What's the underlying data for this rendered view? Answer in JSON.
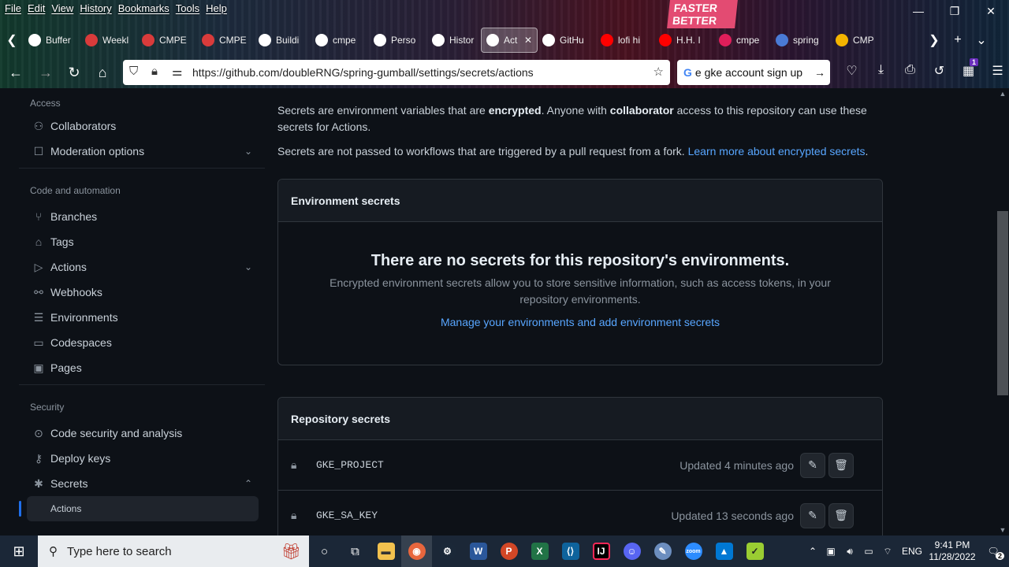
{
  "browser": {
    "menu": [
      "File",
      "Edit",
      "View",
      "History",
      "Bookmarks",
      "Tools",
      "Help"
    ],
    "window_controls": [
      "—",
      "❐",
      "✕"
    ],
    "poster_text": "FASTER BETTER",
    "tabs": [
      {
        "label": "Buffer",
        "color": "#ffffff"
      },
      {
        "label": "Weekl",
        "color": "#d93b3b"
      },
      {
        "label": "CMPE",
        "color": "#d93b3b"
      },
      {
        "label": "CMPE",
        "color": "#d93b3b"
      },
      {
        "label": "Buildi",
        "color": "#ffffff"
      },
      {
        "label": "cmpe",
        "color": "#ffffff"
      },
      {
        "label": "Perso",
        "color": "#ffffff"
      },
      {
        "label": "Histor",
        "color": "#ffffff"
      },
      {
        "label": "Act",
        "color": "#ffffff",
        "active": true
      },
      {
        "label": "GitHu",
        "color": "#ffffff"
      },
      {
        "label": "lofi hi",
        "color": "#ff0000"
      },
      {
        "label": "H.H. I",
        "color": "#ff0000"
      },
      {
        "label": "cmpe",
        "color": "#e01e5a"
      },
      {
        "label": "spring",
        "color": "#4a7bd6"
      },
      {
        "label": "CMP",
        "color": "#f4b400"
      }
    ],
    "url": "https://github.com/doubleRNG/spring-gumball/settings/secrets/actions",
    "search_text": "e gke account sign up",
    "notif_count": "1"
  },
  "sidebar": {
    "sections": [
      {
        "heading": "Access",
        "items": [
          {
            "label": "Collaborators",
            "icon": "person-icon",
            "glyph": "⚇",
            "chevron": false
          },
          {
            "label": "Moderation options",
            "icon": "comment-icon",
            "glyph": "☐",
            "chevron": true
          }
        ]
      },
      {
        "heading": "Code and automation",
        "items": [
          {
            "label": "Branches",
            "icon": "branch-icon",
            "glyph": "⑂",
            "chevron": false
          },
          {
            "label": "Tags",
            "icon": "tag-icon",
            "glyph": "⌂",
            "chevron": false
          },
          {
            "label": "Actions",
            "icon": "play-icon",
            "glyph": "▷",
            "chevron": true
          },
          {
            "label": "Webhooks",
            "icon": "webhook-icon",
            "glyph": "⚯",
            "chevron": false
          },
          {
            "label": "Environments",
            "icon": "server-icon",
            "glyph": "☰",
            "chevron": false
          },
          {
            "label": "Codespaces",
            "icon": "codespaces-icon",
            "glyph": "▭",
            "chevron": false
          },
          {
            "label": "Pages",
            "icon": "browser-icon",
            "glyph": "▣",
            "chevron": false
          }
        ]
      },
      {
        "heading": "Security",
        "items": [
          {
            "label": "Code security and analysis",
            "icon": "codescan-icon",
            "glyph": "⊙",
            "chevron": false
          },
          {
            "label": "Deploy keys",
            "icon": "key-icon",
            "glyph": "⚷",
            "chevron": false
          },
          {
            "label": "Secrets",
            "icon": "asterisk-icon",
            "glyph": "✱",
            "chevron": true,
            "expanded": true
          }
        ],
        "sub_item": "Actions"
      }
    ]
  },
  "main": {
    "intro": {
      "p1_a": "Secrets are environment variables that are ",
      "p1_b": "encrypted",
      "p1_c": ". Anyone with ",
      "p1_d": "collaborator",
      "p1_e": " access to this repository can use these secrets for Actions.",
      "p2": "Secrets are not passed to workflows that are triggered by a pull request from a fork. ",
      "p2_link": "Learn more about encrypted secrets",
      "p2_end": "."
    },
    "env_secrets": {
      "heading": "Environment secrets",
      "blank_title": "There are no secrets for this repository's environments.",
      "blank_desc": "Encrypted environment secrets allow you to store sensitive information, such as access tokens, in your repository environments.",
      "link": "Manage your environments and add environment secrets"
    },
    "repo_secrets": {
      "heading": "Repository secrets",
      "rows": [
        {
          "name": "GKE_PROJECT",
          "updated": "Updated 4 minutes ago"
        },
        {
          "name": "GKE_SA_KEY",
          "updated": "Updated 13 seconds ago"
        }
      ]
    }
  },
  "taskbar": {
    "search_placeholder": "Type here to search",
    "language": "ENG",
    "time": "9:41 PM",
    "date": "11/28/2022",
    "notifications": "2"
  }
}
